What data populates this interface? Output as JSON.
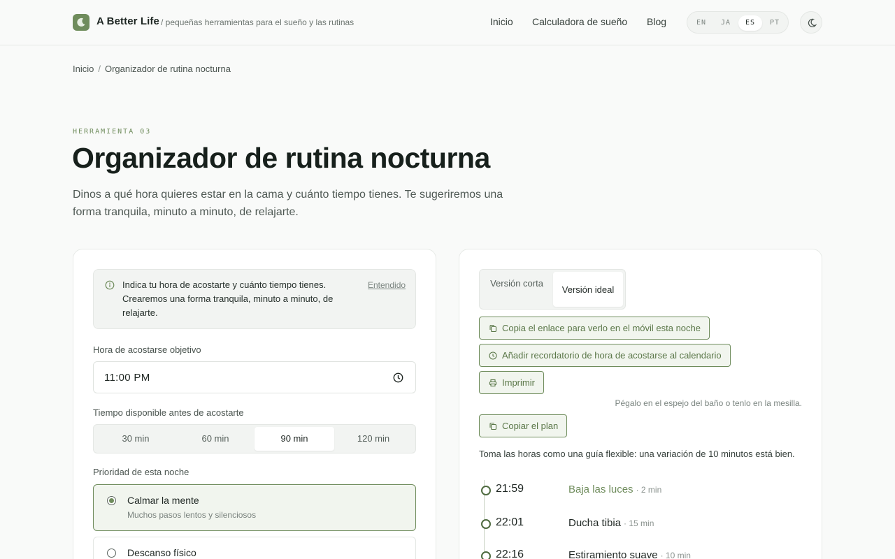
{
  "header": {
    "brand": "A Better Life",
    "tagline": "/ pequeñas herramientas para el sueño y las rutinas",
    "nav": [
      "Inicio",
      "Calculadora de sueño",
      "Blog"
    ],
    "languages": [
      "EN",
      "JA",
      "ES",
      "PT"
    ],
    "active_language": "ES",
    "theme_icon": "moon-icon",
    "logo_icon": "moon-icon"
  },
  "breadcrumb": {
    "home": "Inicio",
    "sep": "/",
    "current": "Organizador de rutina nocturna"
  },
  "hero": {
    "eyebrow": "HERRAMIENTA 03",
    "title": "Organizador de rutina nocturna",
    "lede": "Dinos a qué hora quieres estar en la cama y cuánto tiempo tienes. Te sugeriremos una forma tranquila, minuto a minuto, de relajarte."
  },
  "form": {
    "info_text": "Indica tu hora de acostarte y cuánto tiempo tienes. Crearemos una forma tranquila, minuto a minuto, de relajarte.",
    "info_dismiss": "Entendido",
    "bedtime_label": "Hora de acostarse objetivo",
    "bedtime_value": "11:00 PM",
    "time_label": "Tiempo disponible antes de acostarte",
    "time_options": [
      "30 min",
      "60 min",
      "90 min",
      "120 min"
    ],
    "time_selected": "90 min",
    "priority_label": "Prioridad de esta noche",
    "priorities": [
      {
        "title": "Calmar la mente",
        "subtitle": "Muchos pasos lentos y silenciosos",
        "selected": true
      },
      {
        "title": "Descanso físico",
        "subtitle": "",
        "selected": false
      }
    ]
  },
  "plan": {
    "tabs": [
      "Versión corta",
      "Versión ideal"
    ],
    "active_tab": "Versión ideal",
    "copy_link": "Copia el enlace para verlo en el móvil esta noche",
    "calendar": "Añadir recordatorio de hora de acostarse al calendario",
    "print": "Imprimir",
    "hint": "Pégalo en el espejo del baño o tenlo en la mesilla.",
    "copy_plan": "Copiar el plan",
    "guide": "Toma las horas como una guía flexible: una variación de 10 minutos está bien.",
    "steps": [
      {
        "time": "21:59",
        "name": "Baja las luces",
        "duration": "· 2 min",
        "accent": true
      },
      {
        "time": "22:01",
        "name": "Ducha tibia",
        "duration": "· 15 min",
        "accent": false
      },
      {
        "time": "22:16",
        "name": "Estiramiento suave",
        "duration": "· 10 min",
        "accent": false
      }
    ]
  },
  "colors": {
    "accent": "#6f8c5c",
    "accent_bg": "#f1f5ee",
    "text": "#1f2723",
    "muted": "#7b8580"
  }
}
